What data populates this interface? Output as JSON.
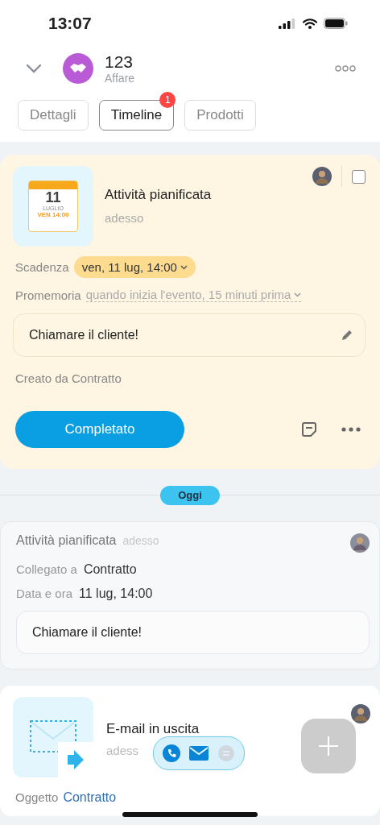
{
  "status_bar": {
    "time": "13:07"
  },
  "header": {
    "title": "123",
    "subtitle": "Affare"
  },
  "tabs": [
    {
      "label": "Dettagli",
      "selected": false
    },
    {
      "label": "Timeline",
      "selected": true,
      "badge": "1"
    },
    {
      "label": "Prodotti",
      "selected": false
    }
  ],
  "activity_card": {
    "calendar": {
      "day": "11",
      "month": "LUGLIO",
      "weekday_time": "VEN 14:00"
    },
    "title": "Attività pianificata",
    "time": "adesso",
    "checked": false,
    "fields": [
      {
        "label": "Scadenza",
        "value": "ven, 11 lug, 14:00",
        "kind": "pill"
      },
      {
        "label": "Promemoria",
        "value": "quando inizia l'evento, 15 minuti prima",
        "kind": "dashed"
      }
    ],
    "note": "Chiamare il cliente!",
    "created_by": "Creato da Contratto",
    "primary_button": "Completato"
  },
  "divider_label": "Oggi",
  "history_card": {
    "title": "Attività pianificata",
    "time": "adesso",
    "rows": [
      {
        "label": "Collegato a",
        "value": "Contratto"
      },
      {
        "label": "Data e ora",
        "value": "11 lug, 14:00"
      }
    ],
    "note": "Chiamare il cliente!"
  },
  "email_card": {
    "title": "E-mail in uscita",
    "time": "adess",
    "subject_label": "Oggetto",
    "subject_value": "Contratto"
  }
}
